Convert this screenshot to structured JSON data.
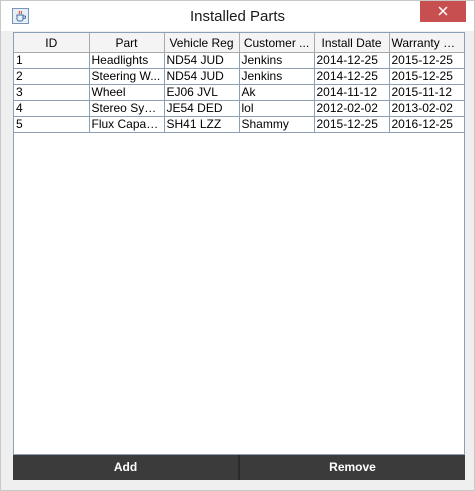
{
  "window": {
    "title": "Installed Parts",
    "icon": "java-cup-icon",
    "close_icon": "close-icon"
  },
  "table": {
    "columns": [
      "ID",
      "Part",
      "Vehicle Reg",
      "Customer ...",
      "Install Date",
      "Warranty Ex..."
    ],
    "rows": [
      [
        "1",
        "Headlights",
        "ND54 JUD",
        "Jenkins",
        "2014-12-25",
        "2015-12-25"
      ],
      [
        "2",
        "Steering W...",
        "ND54 JUD",
        "Jenkins",
        "2014-12-25",
        "2015-12-25"
      ],
      [
        "3",
        "Wheel",
        "EJ06 JVL",
        "Ak",
        "2014-11-12",
        "2015-11-12"
      ],
      [
        "4",
        "Stereo Syst...",
        "JE54 DED",
        "lol",
        "2012-02-02",
        "2013-02-02"
      ],
      [
        "5",
        "Flux Capac...",
        "SH41 LZZ",
        "Shammy",
        "2015-12-25",
        "2016-12-25"
      ]
    ]
  },
  "buttons": {
    "add_label": "Add",
    "remove_label": "Remove"
  },
  "colors": {
    "close_button": "#c74f4f",
    "button_bar": "#3b3b3b",
    "grid_line": "#8c9fb5"
  }
}
